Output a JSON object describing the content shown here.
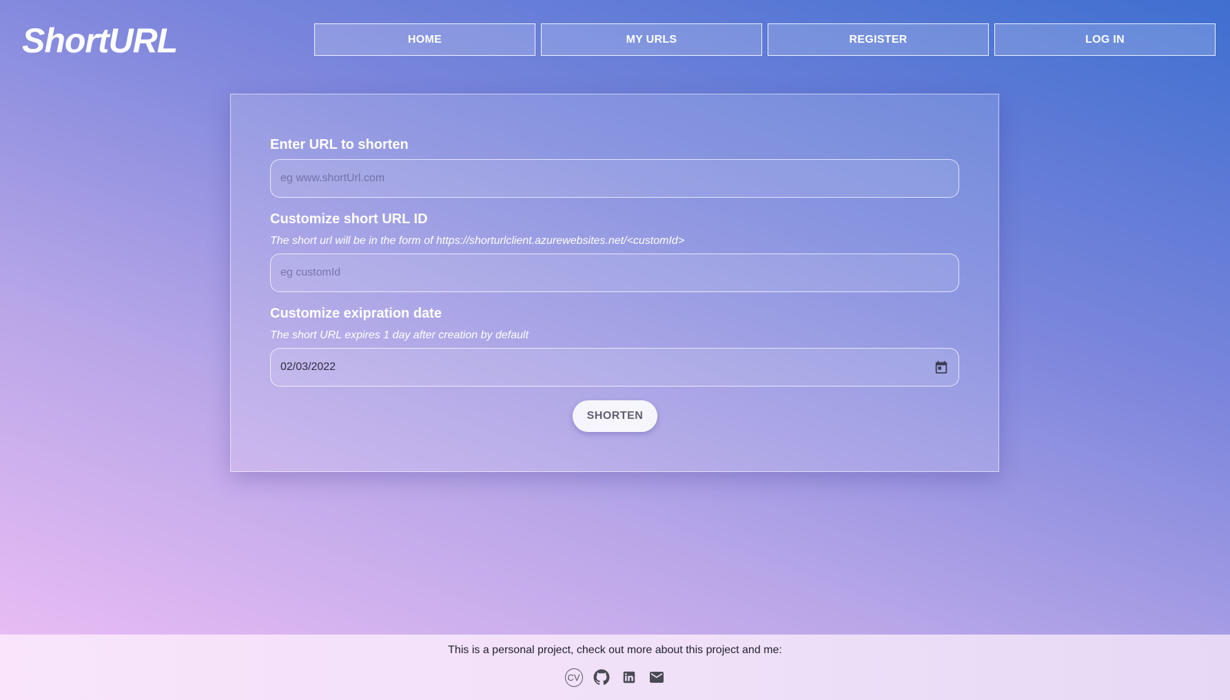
{
  "header": {
    "logo": "ShortURL",
    "nav": [
      {
        "label": "HOME"
      },
      {
        "label": "MY URLS"
      },
      {
        "label": "REGISTER"
      },
      {
        "label": "LOG IN"
      }
    ]
  },
  "form": {
    "url_label": "Enter URL to shorten",
    "url_placeholder": "eg www.shortUrl.com",
    "custom_label": "Customize short URL ID",
    "custom_hint": "The short url will be in the form of https://shorturlclient.azurewebsites.net/<customId>",
    "custom_placeholder": "eg customId",
    "expiration_label": "Customize exipration date",
    "expiration_hint": "The short URL expires 1 day after creation by default",
    "expiration_value": "02/03/2022",
    "submit_label": "SHORTEN"
  },
  "footer": {
    "text": "This is a personal project, check out more about this project and me:",
    "icons": [
      {
        "name": "cv-icon",
        "label": "CV"
      },
      {
        "name": "github-icon"
      },
      {
        "name": "linkedin-icon"
      },
      {
        "name": "email-icon"
      }
    ]
  }
}
